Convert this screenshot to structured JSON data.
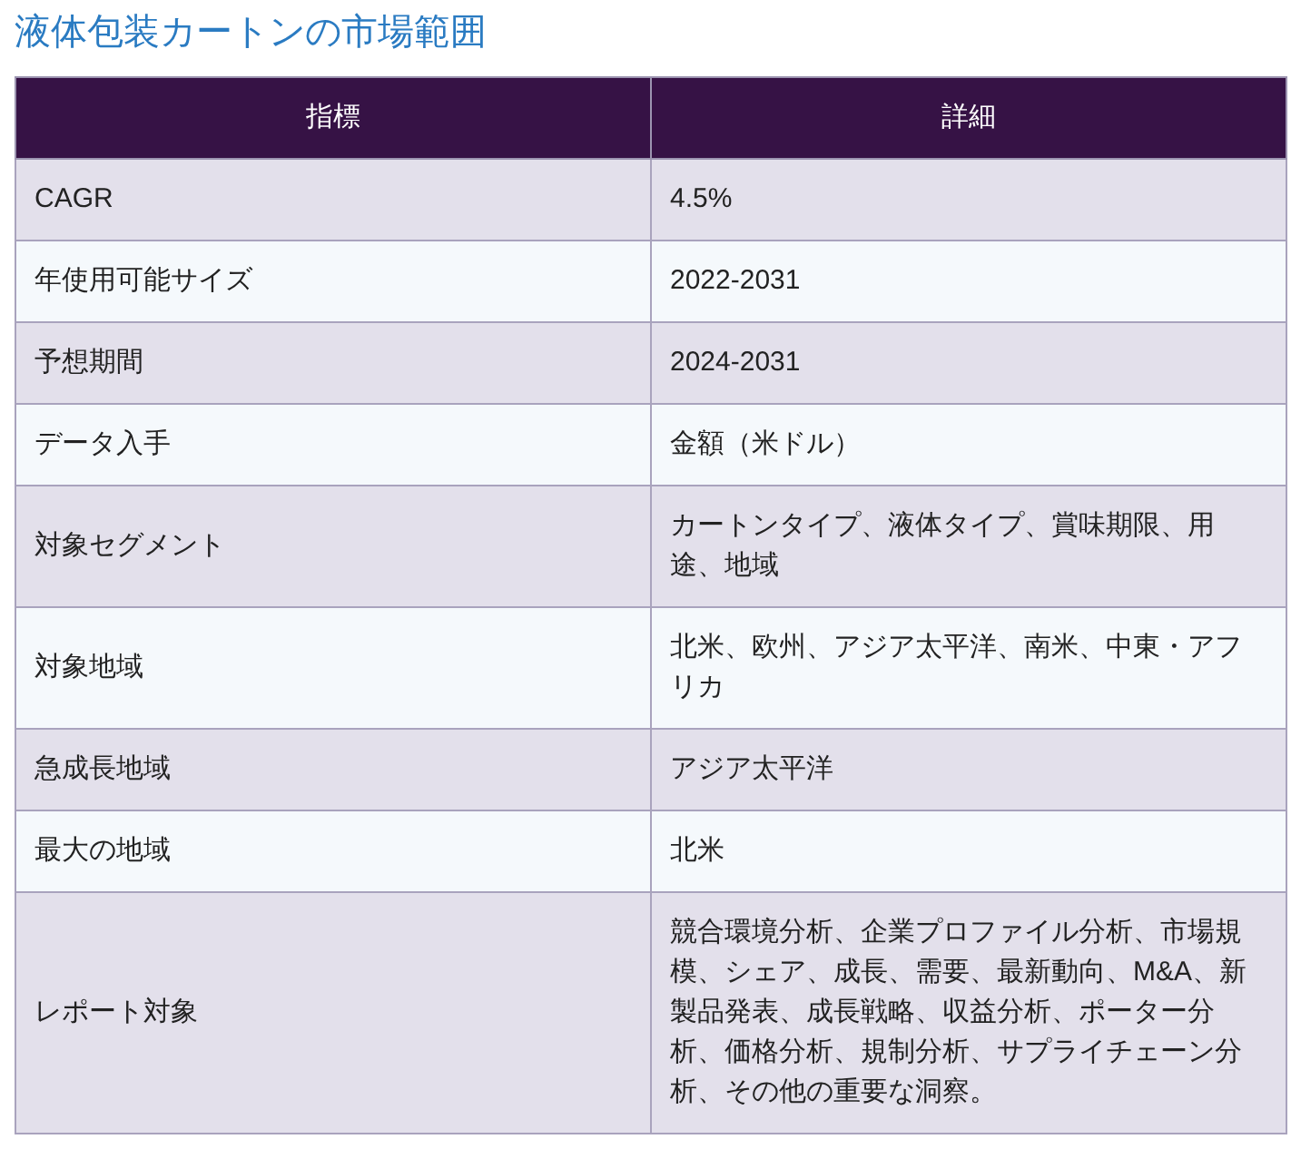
{
  "title": "液体包装カートンの市場範囲",
  "table": {
    "columns": [
      "指標",
      "詳細"
    ],
    "rows": [
      [
        "CAGR",
        "4.5%"
      ],
      [
        "年使用可能サイズ",
        "2022-2031"
      ],
      [
        "予想期間",
        "2024-2031"
      ],
      [
        "データ入手",
        "金額（米ドル）"
      ],
      [
        "対象セグメント",
        "カートンタイプ、液体タイプ、賞味期限、用途、地域"
      ],
      [
        "対象地域",
        "北米、欧州、アジア太平洋、南米、中東・アフリカ"
      ],
      [
        "急成長地域",
        "アジア太平洋"
      ],
      [
        "最大の地域",
        "北米"
      ],
      [
        "レポート対象",
        "競合環境分析、企業プロファイル分析、市場規模、シェア、成長、需要、最新動向、M&A、新製品発表、成長戦略、収益分析、ポーター分析、価格分析、規制分析、サプライチェーン分析、その他の重要な洞察。"
      ]
    ]
  }
}
